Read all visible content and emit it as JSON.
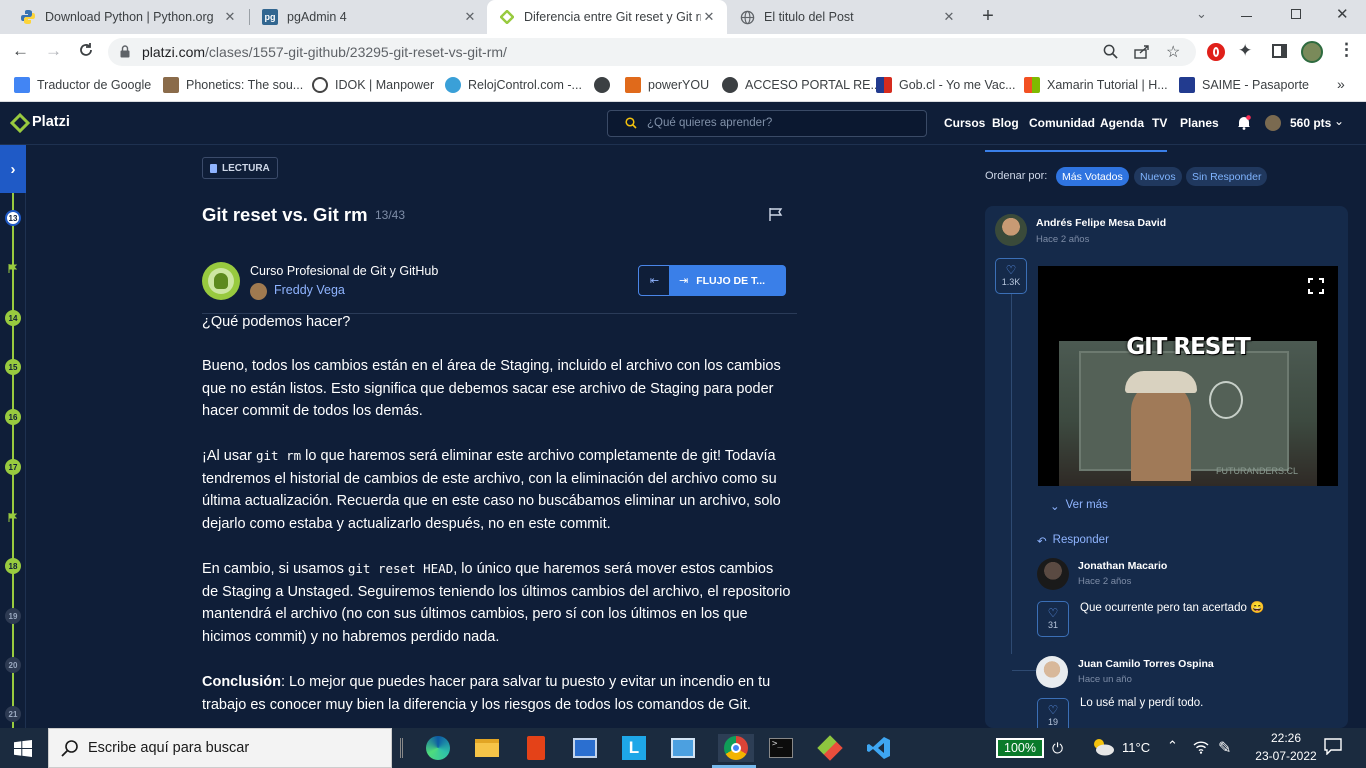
{
  "browser": {
    "tabs": [
      {
        "title": "Download Python | Python.org",
        "close": "✕"
      },
      {
        "title": "pgAdmin 4",
        "close": "✕"
      },
      {
        "title": "Diferencia entre Git reset y Git rm",
        "close": "✕"
      },
      {
        "title": "El titulo del Post",
        "close": "✕"
      }
    ],
    "url_domain": "platzi.com",
    "url_path": "/clases/1557-git-github/23295-git-reset-vs-git-rm/",
    "bookmarks": [
      {
        "label": "Traductor de Google",
        "color": "#4285f4"
      },
      {
        "label": "Phonetics: The sou...",
        "color": "#8a6b4a"
      },
      {
        "label": "IDOK | Manpower",
        "color": "#444444"
      },
      {
        "label": "RelojControl.com -...",
        "color": "#3aa0d8"
      },
      {
        "label": "",
        "color": "#3c4043"
      },
      {
        "label": "powerYOU",
        "color": "#e06a1b"
      },
      {
        "label": "ACCESO PORTAL RE...",
        "color": "#3c4043"
      },
      {
        "label": "Gob.cl - Yo me Vac...",
        "color": "#d52b1e"
      },
      {
        "label": "Xamarin Tutorial | H...",
        "color": "#f2b01e"
      },
      {
        "label": "SAIME - Pasaporte",
        "color": "#223b8f"
      }
    ]
  },
  "platzi": {
    "logo": "Platzi",
    "search_placeholder": "¿Qué quieres aprender?",
    "nav": [
      "Cursos",
      "Blog",
      "Comunidad",
      "Agenda",
      "TV",
      "Planes"
    ],
    "points": "560 pts",
    "accent": "#98ca3f"
  },
  "rail": {
    "nodes": [
      "13",
      "14",
      "15",
      "16",
      "17",
      "18",
      "19",
      "20",
      "21"
    ]
  },
  "article": {
    "badge": "LECTURA",
    "title": "Git reset vs. Git rm",
    "progress": "13/43",
    "course": "Curso Profesional de Git y GitHub",
    "teacher": "Freddy Vega",
    "next_button": "FLUJO DE T...",
    "heading_q": "¿Qué podemos hacer?",
    "p1": "Bueno, todos los cambios están en el área de Staging, incluido el archivo con los cambios que no están listos. Esto significa que debemos sacar ese archivo de Staging para poder hacer commit de todos los demás.",
    "p2_a": "¡Al usar ",
    "p2_code": "git rm",
    "p2_b": " lo que haremos será eliminar este archivo completamente de git! Todavía tendremos el historial de cambios de este archivo, con la eliminación del archivo como su última actualización. Recuerda que en este caso no buscábamos eliminar un archivo, solo dejarlo como estaba y actualizarlo después, no en este commit.",
    "p3_a": "En cambio, si usamos ",
    "p3_code": "git reset HEAD",
    "p3_b": ", lo único que haremos será mover estos cambios de Staging a Unstaged. Seguiremos teniendo los últimos cambios del archivo, el repositorio mantendrá el archivo (no con sus últimos cambios, pero sí con los últimos en los que hicimos commit) y no habremos perdido nada.",
    "p4_bold": "Conclusión",
    "p4_rest": ": Lo mejor que puedes hacer para salvar tu puesto y evitar un incendio en tu trabajo es conocer muy bien la diferencia y los riesgos de todos los comandos de Git."
  },
  "comments": {
    "sort_label": "Ordenar por:",
    "sort_options": [
      "Más Votados",
      "Nuevos",
      "Sin Responder"
    ],
    "main": {
      "author": "Andrés Felipe Mesa David",
      "time": "Hace 2 años",
      "likes": "1.3K",
      "gif_caption": "GIT RESET",
      "gif_watermark": "FUTURANDERS.CL",
      "see_more": "Ver más",
      "reply": "Responder"
    },
    "replies": [
      {
        "author": "Jonathan Macario",
        "time": "Hace 2 años",
        "likes": "31",
        "text": "Que ocurrente pero tan acertado 😄"
      },
      {
        "author": "Juan Camilo Torres Ospina",
        "time": "Hace un año",
        "likes": "19",
        "text": "Lo usé mal y perdí todo."
      }
    ]
  },
  "taskbar": {
    "search_placeholder": "Escribe aquí para buscar",
    "battery": "100%",
    "temperature": "11°C",
    "time": "22:26",
    "date": "23-07-2022"
  }
}
